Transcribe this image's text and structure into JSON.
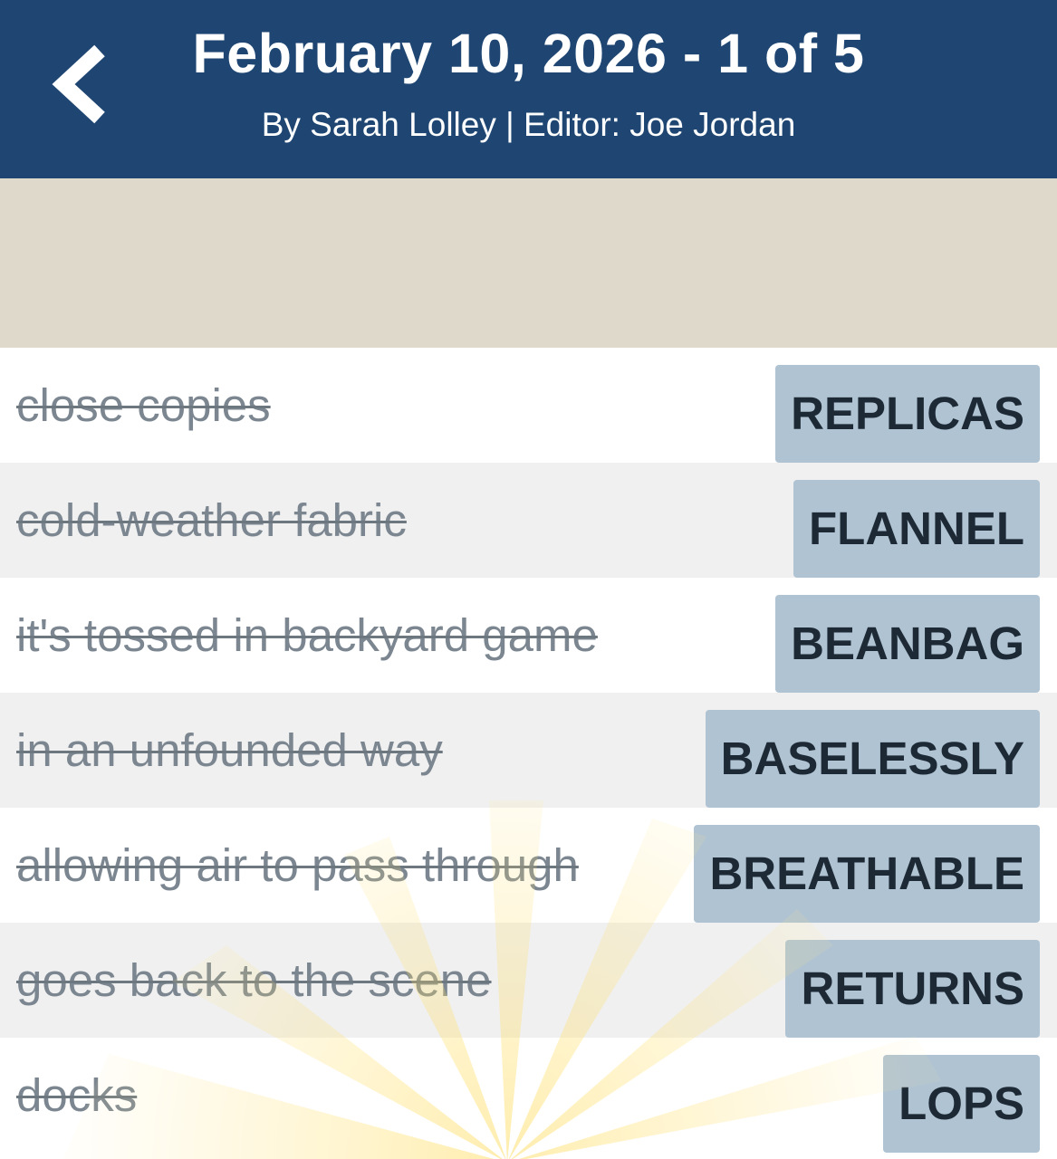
{
  "header": {
    "title": "February 10, 2026 - 1 of 5",
    "subtitle": "By Sarah Lolley | Editor: Joe Jordan",
    "back_icon": "chevron-left-icon",
    "background_color": "#1f4672"
  },
  "colors": {
    "answer_bg": "#b0c3d2",
    "answer_text": "#1d2a36",
    "clue_text": "#7b8690",
    "ad_band": "#dfd9cc"
  },
  "clues": [
    {
      "clue": "close copies",
      "answer": "REPLICAS"
    },
    {
      "clue": "cold-weather fabric",
      "answer": "FLANNEL"
    },
    {
      "clue": "it's tossed in backyard game",
      "answer": "BEANBAG"
    },
    {
      "clue": "in an unfounded way",
      "answer": "BASELESSLY"
    },
    {
      "clue": "allowing air to pass through",
      "answer": "BREATHABLE"
    },
    {
      "clue": "goes back to the scene",
      "answer": "RETURNS"
    },
    {
      "clue": "docks",
      "answer": "LOPS"
    }
  ]
}
